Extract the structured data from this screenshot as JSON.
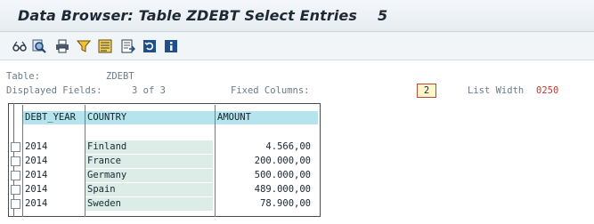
{
  "window": {
    "title": "Data Browser: Table ZDEBT Select Entries",
    "entry_count": "5"
  },
  "toolbar": {
    "buttons": [
      {
        "name": "glasses-icon"
      },
      {
        "name": "search-icon"
      },
      {
        "name": "print-icon"
      },
      {
        "name": "filter-icon"
      },
      {
        "name": "layout-icon"
      },
      {
        "name": "export-icon"
      },
      {
        "name": "refresh-icon"
      },
      {
        "name": "info-icon"
      }
    ]
  },
  "info": {
    "table_label": "Table:",
    "table_value": "ZDEBT",
    "displayed_label": "Displayed Fields:",
    "displayed_value": "3 of  3",
    "fixed_label": "Fixed Columns:",
    "fixed_value": "2",
    "listwidth_label": "List Width",
    "listwidth_value": "0250"
  },
  "table": {
    "headers": [
      "DEBT_YEAR",
      "COUNTRY",
      "AMOUNT"
    ],
    "rows": [
      [
        "2014",
        "Finland",
        "4.566,00"
      ],
      [
        "2014",
        "France",
        "200.000,00"
      ],
      [
        "2014",
        "Germany",
        "500.000,00"
      ],
      [
        "2014",
        "Spain",
        "489.000,00"
      ],
      [
        "2014",
        "Sweden",
        "78.900,00"
      ]
    ]
  },
  "colors": {
    "header_bg": "#b6e4ec",
    "key_cell_bg": "#dcede8",
    "list_width_value": "#c23a2d"
  }
}
